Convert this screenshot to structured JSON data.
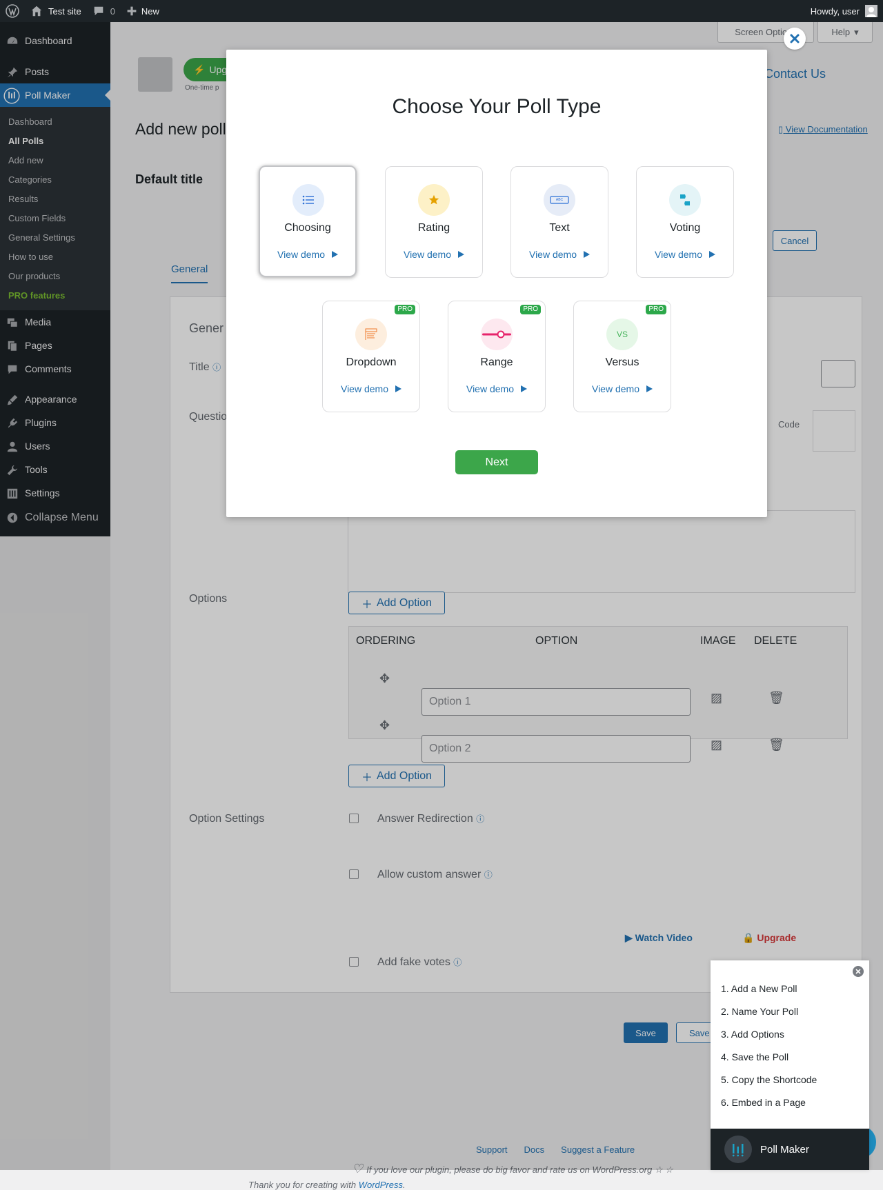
{
  "admin_bar": {
    "site_name": "Test site",
    "comments_count": "0",
    "new_label": "New",
    "howdy": "Howdy, user"
  },
  "sidebar": {
    "dashboard": "Dashboard",
    "posts": "Posts",
    "poll_maker": "Poll Maker",
    "submenu": [
      "Dashboard",
      "All Polls",
      "Add new",
      "Categories",
      "Results",
      "Custom Fields",
      "General Settings",
      "How to use",
      "Our products",
      "PRO features"
    ],
    "media": "Media",
    "pages": "Pages",
    "comments": "Comments",
    "appearance": "Appearance",
    "plugins": "Plugins",
    "users": "Users",
    "tools": "Tools",
    "settings": "Settings",
    "collapse": "Collapse Menu"
  },
  "background": {
    "screen_options": "Screen Options",
    "help": "Help",
    "upgrade_fragment": "Upg",
    "one_time_fragment": "One-time p",
    "contact_us": "Contact Us",
    "page_title_fragment": "Add new poll",
    "view_documentation": "View Documentation",
    "default_title": "Default title",
    "cancel": "Cancel",
    "tab_general": "General",
    "section_fragment": "Gener",
    "title_label": "Title",
    "question_fragment": "Questio",
    "code_label": "Code",
    "options_label": "Options",
    "add_option": "Add Option",
    "table_headers": [
      "ORDERING",
      "OPTION",
      "IMAGE",
      "DELETE"
    ],
    "option_placeholders": [
      "Option 1",
      "Option 2"
    ],
    "option_settings": "Option Settings",
    "answer_redirection": "Answer Redirection",
    "allow_custom_answer": "Allow custom answer",
    "watch_video": "Watch Video",
    "upgrade": "Upgrade",
    "add_fake_votes": "Add fake votes",
    "save": "Save",
    "save_fragment": "Save",
    "footer_links": [
      "Support",
      "Docs",
      "Suggest a Feature"
    ],
    "love_text": "If you love our plugin, please do big favor and rate us on WordPress.org",
    "thank_you": "Thank you for creating with",
    "wordpress_link": "WordPress"
  },
  "modal": {
    "title": "Choose Your Poll Type",
    "view_demo": "View demo",
    "pro_badge": "PRO",
    "types": [
      "Choosing",
      "Rating",
      "Text",
      "Voting",
      "Dropdown",
      "Range",
      "Versus"
    ],
    "text_icon_label": "ABC",
    "versus_icon_label": "VS",
    "next": "Next"
  },
  "guide": {
    "steps": [
      "1. Add a New Poll",
      "2. Name Your Poll",
      "3. Add Options",
      "4. Save the Poll",
      "5. Copy the Shortcode",
      "6. Embed in a Page"
    ],
    "brand": "Poll Maker"
  },
  "colors": {
    "wp_dark": "#1d2327",
    "wp_blue": "#2271b1",
    "next_green": "#3ca64a",
    "pro_green": "#2ca84a"
  }
}
